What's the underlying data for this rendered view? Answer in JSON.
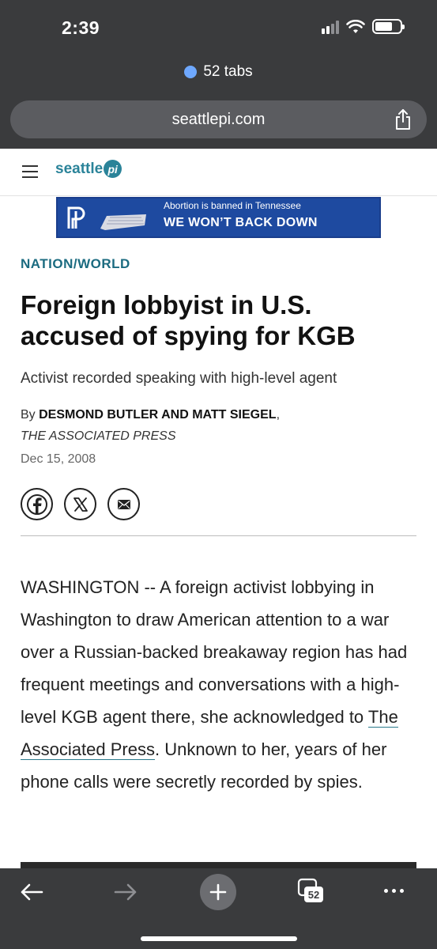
{
  "status_bar": {
    "time": "2:39"
  },
  "browser": {
    "tabs_label": "52 tabs",
    "url": "seattlepi.com",
    "tab_count": "52"
  },
  "site": {
    "logo_text": "seattle",
    "logo_badge": "pi"
  },
  "ad": {
    "line1": "Abortion is banned in Tennessee",
    "line2": "WE WON’T BACK DOWN"
  },
  "article": {
    "category": "NATION/WORLD",
    "headline": "Foreign lobbyist in U.S. accused of spying for KGB",
    "subheadline": "Activist recorded speaking with high-level agent",
    "byline_prefix": "By ",
    "authors": "DESMOND BUTLER AND MATT SIEGEL",
    "byline_suffix": ",",
    "organization": "THE ASSOCIATED PRESS",
    "date": "Dec 15, 2008",
    "body_before_link": "WASHINGTON -- A foreign activist lobbying in Washington to draw American attention to a war over a Russian-backed breakaway region has had frequent meetings and conversations with a high-level KGB agent there, she acknowledged to ",
    "body_link": "The Associated Press",
    "body_after_link": ". Unknown to her, years of her phone calls were secretly recorded by spies."
  },
  "icons": {
    "share": "share-icon",
    "menu": "hamburger-menu-icon",
    "facebook": "facebook-icon",
    "x": "x-icon",
    "email": "email-icon",
    "back": "back-arrow-icon",
    "forward": "forward-arrow-icon",
    "new_tab": "plus-icon",
    "tabs": "tabs-icon",
    "more": "more-icon"
  },
  "colors": {
    "chrome_bg": "#3a3b3d",
    "url_bar_bg": "#5b5c60",
    "tabs_dot": "#6ea8ff",
    "brand_teal": "#1b6b80",
    "logo_teal": "#2a8399",
    "ad_blue": "#1a3e8c",
    "ad_bg": "#1e4aa0"
  }
}
